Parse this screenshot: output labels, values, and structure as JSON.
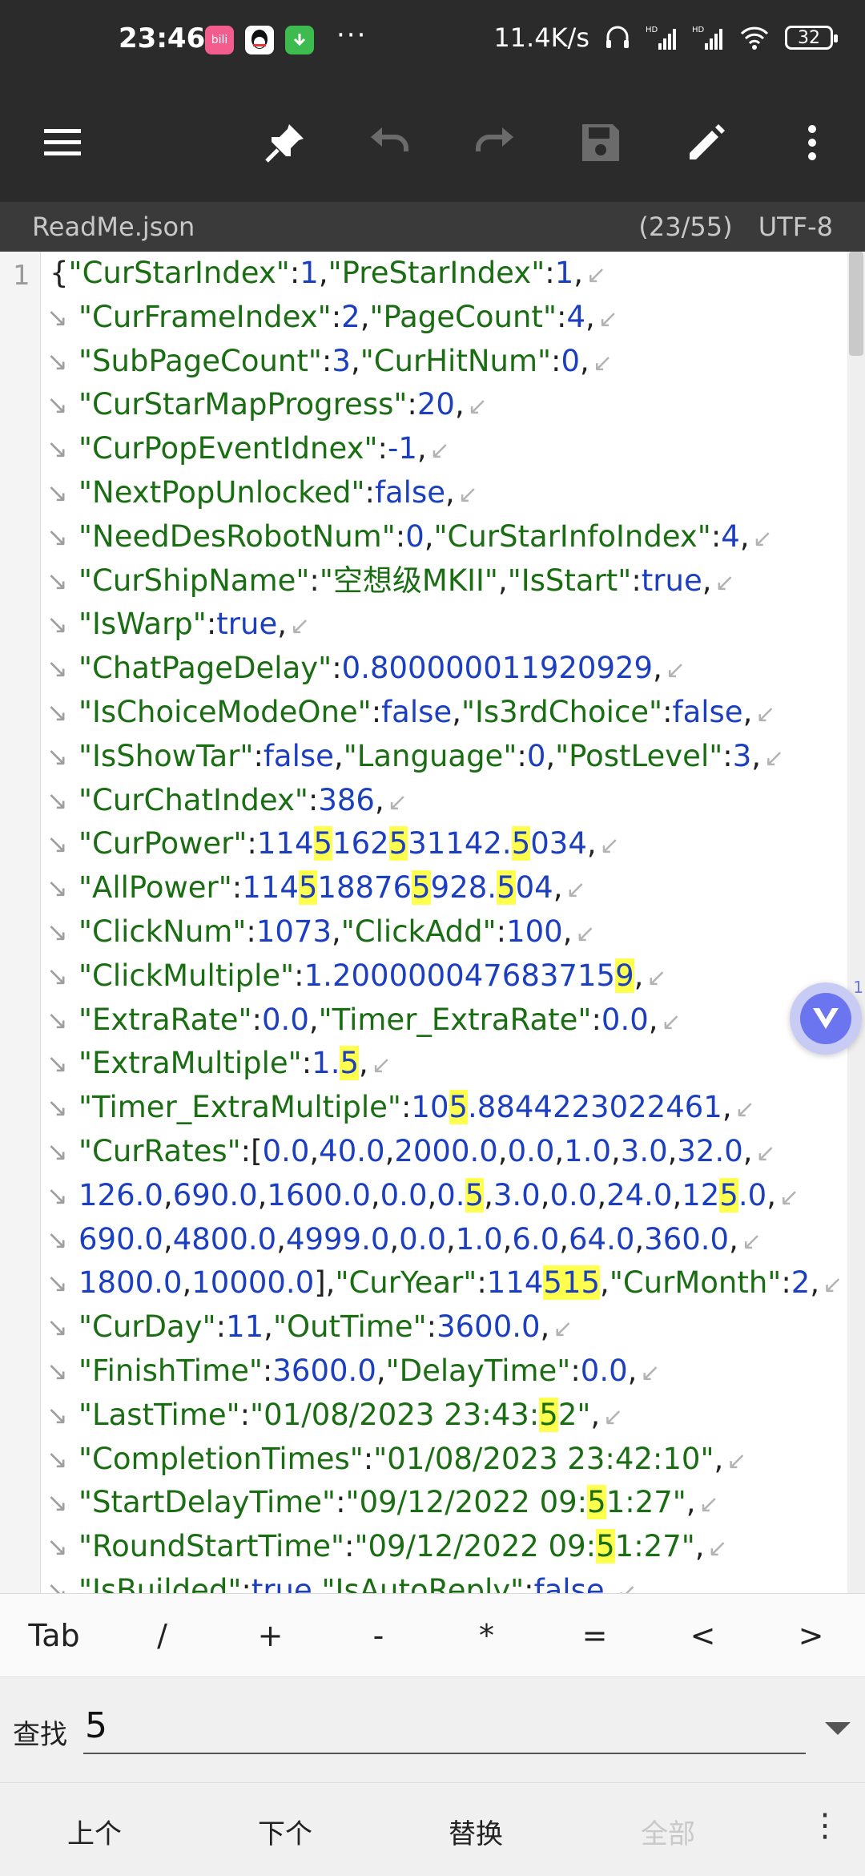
{
  "status": {
    "time": "23:46",
    "dots": "···",
    "speed": "11.4K/s",
    "battery": "32"
  },
  "toolbar": {
    "menu": "menu-icon",
    "pin": "pin-icon",
    "undo": "undo-icon",
    "redo": "redo-icon",
    "save": "save-icon",
    "edit": "pencil-icon",
    "more": "more-vertical-icon"
  },
  "file": {
    "name": "ReadMe.json",
    "position": "(23/55)",
    "encoding": "UTF-8"
  },
  "editor": {
    "line_number": "1",
    "floating_count": "1",
    "lines": [
      [
        [
          "p",
          "{"
        ],
        [
          "k",
          "\"CurStarIndex\""
        ],
        [
          "p",
          ":"
        ],
        [
          "n",
          "1"
        ],
        [
          "p",
          ","
        ],
        [
          "k",
          "\"PreStarIndex\""
        ],
        [
          "p",
          ":"
        ],
        [
          "n",
          "1"
        ],
        [
          "p",
          ","
        ]
      ],
      [
        [
          "k",
          "\"CurFrameIndex\""
        ],
        [
          "p",
          ":"
        ],
        [
          "n",
          "2"
        ],
        [
          "p",
          ","
        ],
        [
          "k",
          "\"PageCount\""
        ],
        [
          "p",
          ":"
        ],
        [
          "n",
          "4"
        ],
        [
          "p",
          ","
        ]
      ],
      [
        [
          "k",
          "\"SubPageCount\""
        ],
        [
          "p",
          ":"
        ],
        [
          "n",
          "3"
        ],
        [
          "p",
          ","
        ],
        [
          "k",
          "\"CurHitNum\""
        ],
        [
          "p",
          ":"
        ],
        [
          "n",
          "0"
        ],
        [
          "p",
          ","
        ]
      ],
      [
        [
          "k",
          "\"CurStarMapProgress\""
        ],
        [
          "p",
          ":"
        ],
        [
          "n",
          "20"
        ],
        [
          "p",
          ","
        ]
      ],
      [
        [
          "k",
          "\"CurPopEventIdnex\""
        ],
        [
          "p",
          ":"
        ],
        [
          "n",
          "-1"
        ],
        [
          "p",
          ","
        ]
      ],
      [
        [
          "k",
          "\"NextPopUnlocked\""
        ],
        [
          "p",
          ":"
        ],
        [
          "n",
          "false"
        ],
        [
          "p",
          ","
        ]
      ],
      [
        [
          "k",
          "\"NeedDesRobotNum\""
        ],
        [
          "p",
          ":"
        ],
        [
          "n",
          "0"
        ],
        [
          "p",
          ","
        ],
        [
          "k",
          "\"CurStarInfoIndex\""
        ],
        [
          "p",
          ":"
        ],
        [
          "n",
          "4"
        ],
        [
          "p",
          ","
        ]
      ],
      [
        [
          "k",
          "\"CurShipName\""
        ],
        [
          "p",
          ":"
        ],
        [
          "s",
          "\"空想级MKII\""
        ],
        [
          "p",
          ","
        ],
        [
          "k",
          "\"IsStart\""
        ],
        [
          "p",
          ":"
        ],
        [
          "n",
          "true"
        ],
        [
          "p",
          ","
        ]
      ],
      [
        [
          "k",
          "\"IsWarp\""
        ],
        [
          "p",
          ":"
        ],
        [
          "n",
          "true"
        ],
        [
          "p",
          ","
        ]
      ],
      [
        [
          "k",
          "\"ChatPageDelay\""
        ],
        [
          "p",
          ":"
        ],
        [
          "n",
          "0.800000011920929"
        ],
        [
          "p",
          ","
        ]
      ],
      [
        [
          "k",
          "\"IsChoiceModeOne\""
        ],
        [
          "p",
          ":"
        ],
        [
          "n",
          "false"
        ],
        [
          "p",
          ","
        ],
        [
          "k",
          "\"Is3rdChoice\""
        ],
        [
          "p",
          ":"
        ],
        [
          "n",
          "false"
        ],
        [
          "p",
          ","
        ]
      ],
      [
        [
          "k",
          "\"IsShowTar\""
        ],
        [
          "p",
          ":"
        ],
        [
          "n",
          "false"
        ],
        [
          "p",
          ","
        ],
        [
          "k",
          "\"Language\""
        ],
        [
          "p",
          ":"
        ],
        [
          "n",
          "0"
        ],
        [
          "p",
          ","
        ],
        [
          "k",
          "\"PostLevel\""
        ],
        [
          "p",
          ":"
        ],
        [
          "n",
          "3"
        ],
        [
          "p",
          ","
        ]
      ],
      [
        [
          "k",
          "\"CurChatIndex\""
        ],
        [
          "p",
          ":"
        ],
        [
          "n",
          "386"
        ],
        [
          "p",
          ","
        ]
      ],
      [
        [
          "k",
          "\"CurPower\""
        ],
        [
          "p",
          ":"
        ],
        [
          "n",
          "114"
        ],
        [
          "nh",
          "5"
        ],
        [
          "n",
          "162"
        ],
        [
          "nh",
          "5"
        ],
        [
          "n",
          "31142."
        ],
        [
          "nh",
          "5"
        ],
        [
          "n",
          "034"
        ],
        [
          "p",
          ","
        ]
      ],
      [
        [
          "k",
          "\"AllPower\""
        ],
        [
          "p",
          ":"
        ],
        [
          "n",
          "114"
        ],
        [
          "nh",
          "5"
        ],
        [
          "n",
          "18876"
        ],
        [
          "nh",
          "5"
        ],
        [
          "n",
          "928."
        ],
        [
          "nh",
          "5"
        ],
        [
          "n",
          "04"
        ],
        [
          "p",
          ","
        ]
      ],
      [
        [
          "k",
          "\"ClickNum\""
        ],
        [
          "p",
          ":"
        ],
        [
          "n",
          "1073"
        ],
        [
          "p",
          ","
        ],
        [
          "k",
          "\"ClickAdd\""
        ],
        [
          "p",
          ":"
        ],
        [
          "n",
          "100"
        ],
        [
          "p",
          ","
        ]
      ],
      [
        [
          "k",
          "\"ClickMultiple\""
        ],
        [
          "p",
          ":"
        ],
        [
          "n",
          "1.200000047683715"
        ],
        [
          "nh",
          "9"
        ],
        [
          "p",
          ","
        ]
      ],
      [
        [
          "k",
          "\"ExtraRate\""
        ],
        [
          "p",
          ":"
        ],
        [
          "n",
          "0.0"
        ],
        [
          "p",
          ","
        ],
        [
          "k",
          "\"Timer_ExtraRate\""
        ],
        [
          "p",
          ":"
        ],
        [
          "n",
          "0.0"
        ],
        [
          "p",
          ","
        ]
      ],
      [
        [
          "k",
          "\"ExtraMultiple\""
        ],
        [
          "p",
          ":"
        ],
        [
          "n",
          "1."
        ],
        [
          "nh",
          "5"
        ],
        [
          "p",
          ","
        ]
      ],
      [
        [
          "k",
          "\"Timer_ExtraMultiple\""
        ],
        [
          "p",
          ":"
        ],
        [
          "n",
          "10"
        ],
        [
          "nh",
          "5"
        ],
        [
          "n",
          ".8844223022461"
        ],
        [
          "p",
          ","
        ]
      ],
      [
        [
          "k",
          "\"CurRates\""
        ],
        [
          "p",
          ":["
        ],
        [
          "n",
          "0.0"
        ],
        [
          "p",
          ","
        ],
        [
          "n",
          "40.0"
        ],
        [
          "p",
          ","
        ],
        [
          "n",
          "2000.0"
        ],
        [
          "p",
          ","
        ],
        [
          "n",
          "0.0"
        ],
        [
          "p",
          ","
        ],
        [
          "n",
          "1.0"
        ],
        [
          "p",
          ","
        ],
        [
          "n",
          "3.0"
        ],
        [
          "p",
          ","
        ],
        [
          "n",
          "32.0"
        ],
        [
          "p",
          ","
        ]
      ],
      [
        [
          "n",
          "126.0"
        ],
        [
          "p",
          ","
        ],
        [
          "n",
          "690.0"
        ],
        [
          "p",
          ","
        ],
        [
          "n",
          "1600.0"
        ],
        [
          "p",
          ","
        ],
        [
          "n",
          "0.0"
        ],
        [
          "p",
          ","
        ],
        [
          "n",
          "0."
        ],
        [
          "nh",
          "5"
        ],
        [
          "p",
          ","
        ],
        [
          "n",
          "3.0"
        ],
        [
          "p",
          ","
        ],
        [
          "n",
          "0.0"
        ],
        [
          "p",
          ","
        ],
        [
          "n",
          "24.0"
        ],
        [
          "p",
          ","
        ],
        [
          "n",
          "12"
        ],
        [
          "nh",
          "5"
        ],
        [
          "n",
          ".0"
        ],
        [
          "p",
          ","
        ]
      ],
      [
        [
          "n",
          "690.0"
        ],
        [
          "p",
          ","
        ],
        [
          "n",
          "4800.0"
        ],
        [
          "p",
          ","
        ],
        [
          "n",
          "4999.0"
        ],
        [
          "p",
          ","
        ],
        [
          "n",
          "0.0"
        ],
        [
          "p",
          ","
        ],
        [
          "n",
          "1.0"
        ],
        [
          "p",
          ","
        ],
        [
          "n",
          "6.0"
        ],
        [
          "p",
          ","
        ],
        [
          "n",
          "64.0"
        ],
        [
          "p",
          ","
        ],
        [
          "n",
          "360.0"
        ],
        [
          "p",
          ","
        ]
      ],
      [
        [
          "n",
          "1800.0"
        ],
        [
          "p",
          ","
        ],
        [
          "n",
          "10000.0"
        ],
        [
          "p",
          "],"
        ],
        [
          "k",
          "\"CurYear\""
        ],
        [
          "p",
          ":"
        ],
        [
          "n",
          "114"
        ],
        [
          "nh",
          "515"
        ],
        [
          "p",
          ","
        ],
        [
          "k",
          "\"CurMonth\""
        ],
        [
          "p",
          ":"
        ],
        [
          "n",
          "2"
        ],
        [
          "p",
          ","
        ]
      ],
      [
        [
          "k",
          "\"CurDay\""
        ],
        [
          "p",
          ":"
        ],
        [
          "n",
          "11"
        ],
        [
          "p",
          ","
        ],
        [
          "k",
          "\"OutTime\""
        ],
        [
          "p",
          ":"
        ],
        [
          "n",
          "3600.0"
        ],
        [
          "p",
          ","
        ]
      ],
      [
        [
          "k",
          "\"FinishTime\""
        ],
        [
          "p",
          ":"
        ],
        [
          "n",
          "3600.0"
        ],
        [
          "p",
          ","
        ],
        [
          "k",
          "\"DelayTime\""
        ],
        [
          "p",
          ":"
        ],
        [
          "n",
          "0.0"
        ],
        [
          "p",
          ","
        ]
      ],
      [
        [
          "k",
          "\"LastTime\""
        ],
        [
          "p",
          ":"
        ],
        [
          "s",
          "\"01/08/2023 23:43:"
        ],
        [
          "sh",
          "5"
        ],
        [
          "s",
          "2\""
        ],
        [
          "p",
          ","
        ]
      ],
      [
        [
          "k",
          "\"CompletionTimes\""
        ],
        [
          "p",
          ":"
        ],
        [
          "s",
          "\"01/08/2023 23:42:10\""
        ],
        [
          "p",
          ","
        ]
      ],
      [
        [
          "k",
          "\"StartDelayTime\""
        ],
        [
          "p",
          ":"
        ],
        [
          "s",
          "\"09/12/2022 09:"
        ],
        [
          "sh",
          "5"
        ],
        [
          "s",
          "1:27\""
        ],
        [
          "p",
          ","
        ]
      ],
      [
        [
          "k",
          "\"RoundStartTime\""
        ],
        [
          "p",
          ":"
        ],
        [
          "s",
          "\"09/12/2022 09:"
        ],
        [
          "sh",
          "5"
        ],
        [
          "s",
          "1:27\""
        ],
        [
          "p",
          ","
        ]
      ],
      [
        [
          "k",
          "\"IsBuilded\""
        ],
        [
          "p",
          ":"
        ],
        [
          "n",
          "true"
        ],
        [
          "p",
          ","
        ],
        [
          "k",
          "\"IsAutoReply\""
        ],
        [
          "p",
          ":"
        ],
        [
          "n",
          "false"
        ],
        [
          "p",
          ","
        ]
      ]
    ]
  },
  "symbols": [
    "Tab",
    "/",
    "+",
    "-",
    "*",
    "=",
    "<",
    ">"
  ],
  "find": {
    "label": "查找",
    "value": "5"
  },
  "actions": {
    "prev": "上个",
    "next": "下个",
    "replace": "替换",
    "all": "全部",
    "more": "⋮"
  }
}
